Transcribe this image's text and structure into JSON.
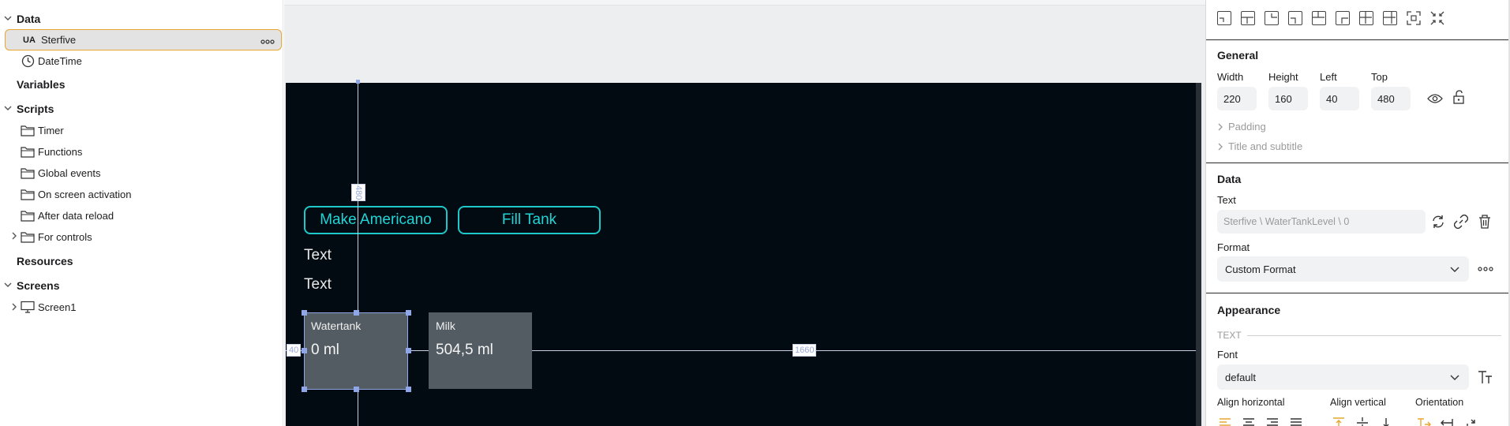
{
  "tree": {
    "data_header": "Data",
    "data_items": [
      {
        "label": "Sterfive",
        "icon": "ua-server-icon"
      },
      {
        "label": "DateTime",
        "icon": "clock-icon"
      }
    ],
    "variables_header": "Variables",
    "scripts_header": "Scripts",
    "script_items": [
      {
        "label": "Timer"
      },
      {
        "label": "Functions"
      },
      {
        "label": "Global events"
      },
      {
        "label": "On screen activation"
      },
      {
        "label": "After data reload"
      },
      {
        "label": "For controls"
      }
    ],
    "resources_header": "Resources",
    "screens_header": "Screens",
    "screen_items": [
      {
        "label": "Screen1"
      }
    ],
    "more_glyph": "ooo"
  },
  "canvas": {
    "buttons": [
      {
        "label": "Make Americano"
      },
      {
        "label": "Fill Tank"
      }
    ],
    "texts": [
      "Text",
      "Text"
    ],
    "tiles": [
      {
        "title": "Watertank",
        "value": "0 ml"
      },
      {
        "title": "Milk",
        "value": "504,5 ml"
      }
    ],
    "dim_top": "480",
    "dim_left": "40",
    "dim_right": "1660",
    "colors": {
      "screen_bg": "#020a12",
      "accent": "#1fc8c8",
      "tile": "#535c62",
      "guide": "#8fa6e8"
    }
  },
  "panel": {
    "general_title": "General",
    "width_label": "Width",
    "height_label": "Height",
    "left_label": "Left",
    "top_label": "Top",
    "width_value": "220",
    "height_value": "160",
    "left_value": "40",
    "top_value": "480",
    "padding_label": "Padding",
    "title_subtitle_label": "Title and subtitle",
    "data_title": "Data",
    "text_label": "Text",
    "text_binding": "Sterfive \\ WaterTankLevel \\ 0",
    "format_label": "Format",
    "format_value": "Custom Format",
    "appearance_title": "Appearance",
    "text_section": "TEXT",
    "font_label": "Font",
    "font_value": "default",
    "align_h_label": "Align horizontal",
    "align_v_label": "Align vertical",
    "orientation_label": "Orientation",
    "accent_color": "#e8a630"
  }
}
